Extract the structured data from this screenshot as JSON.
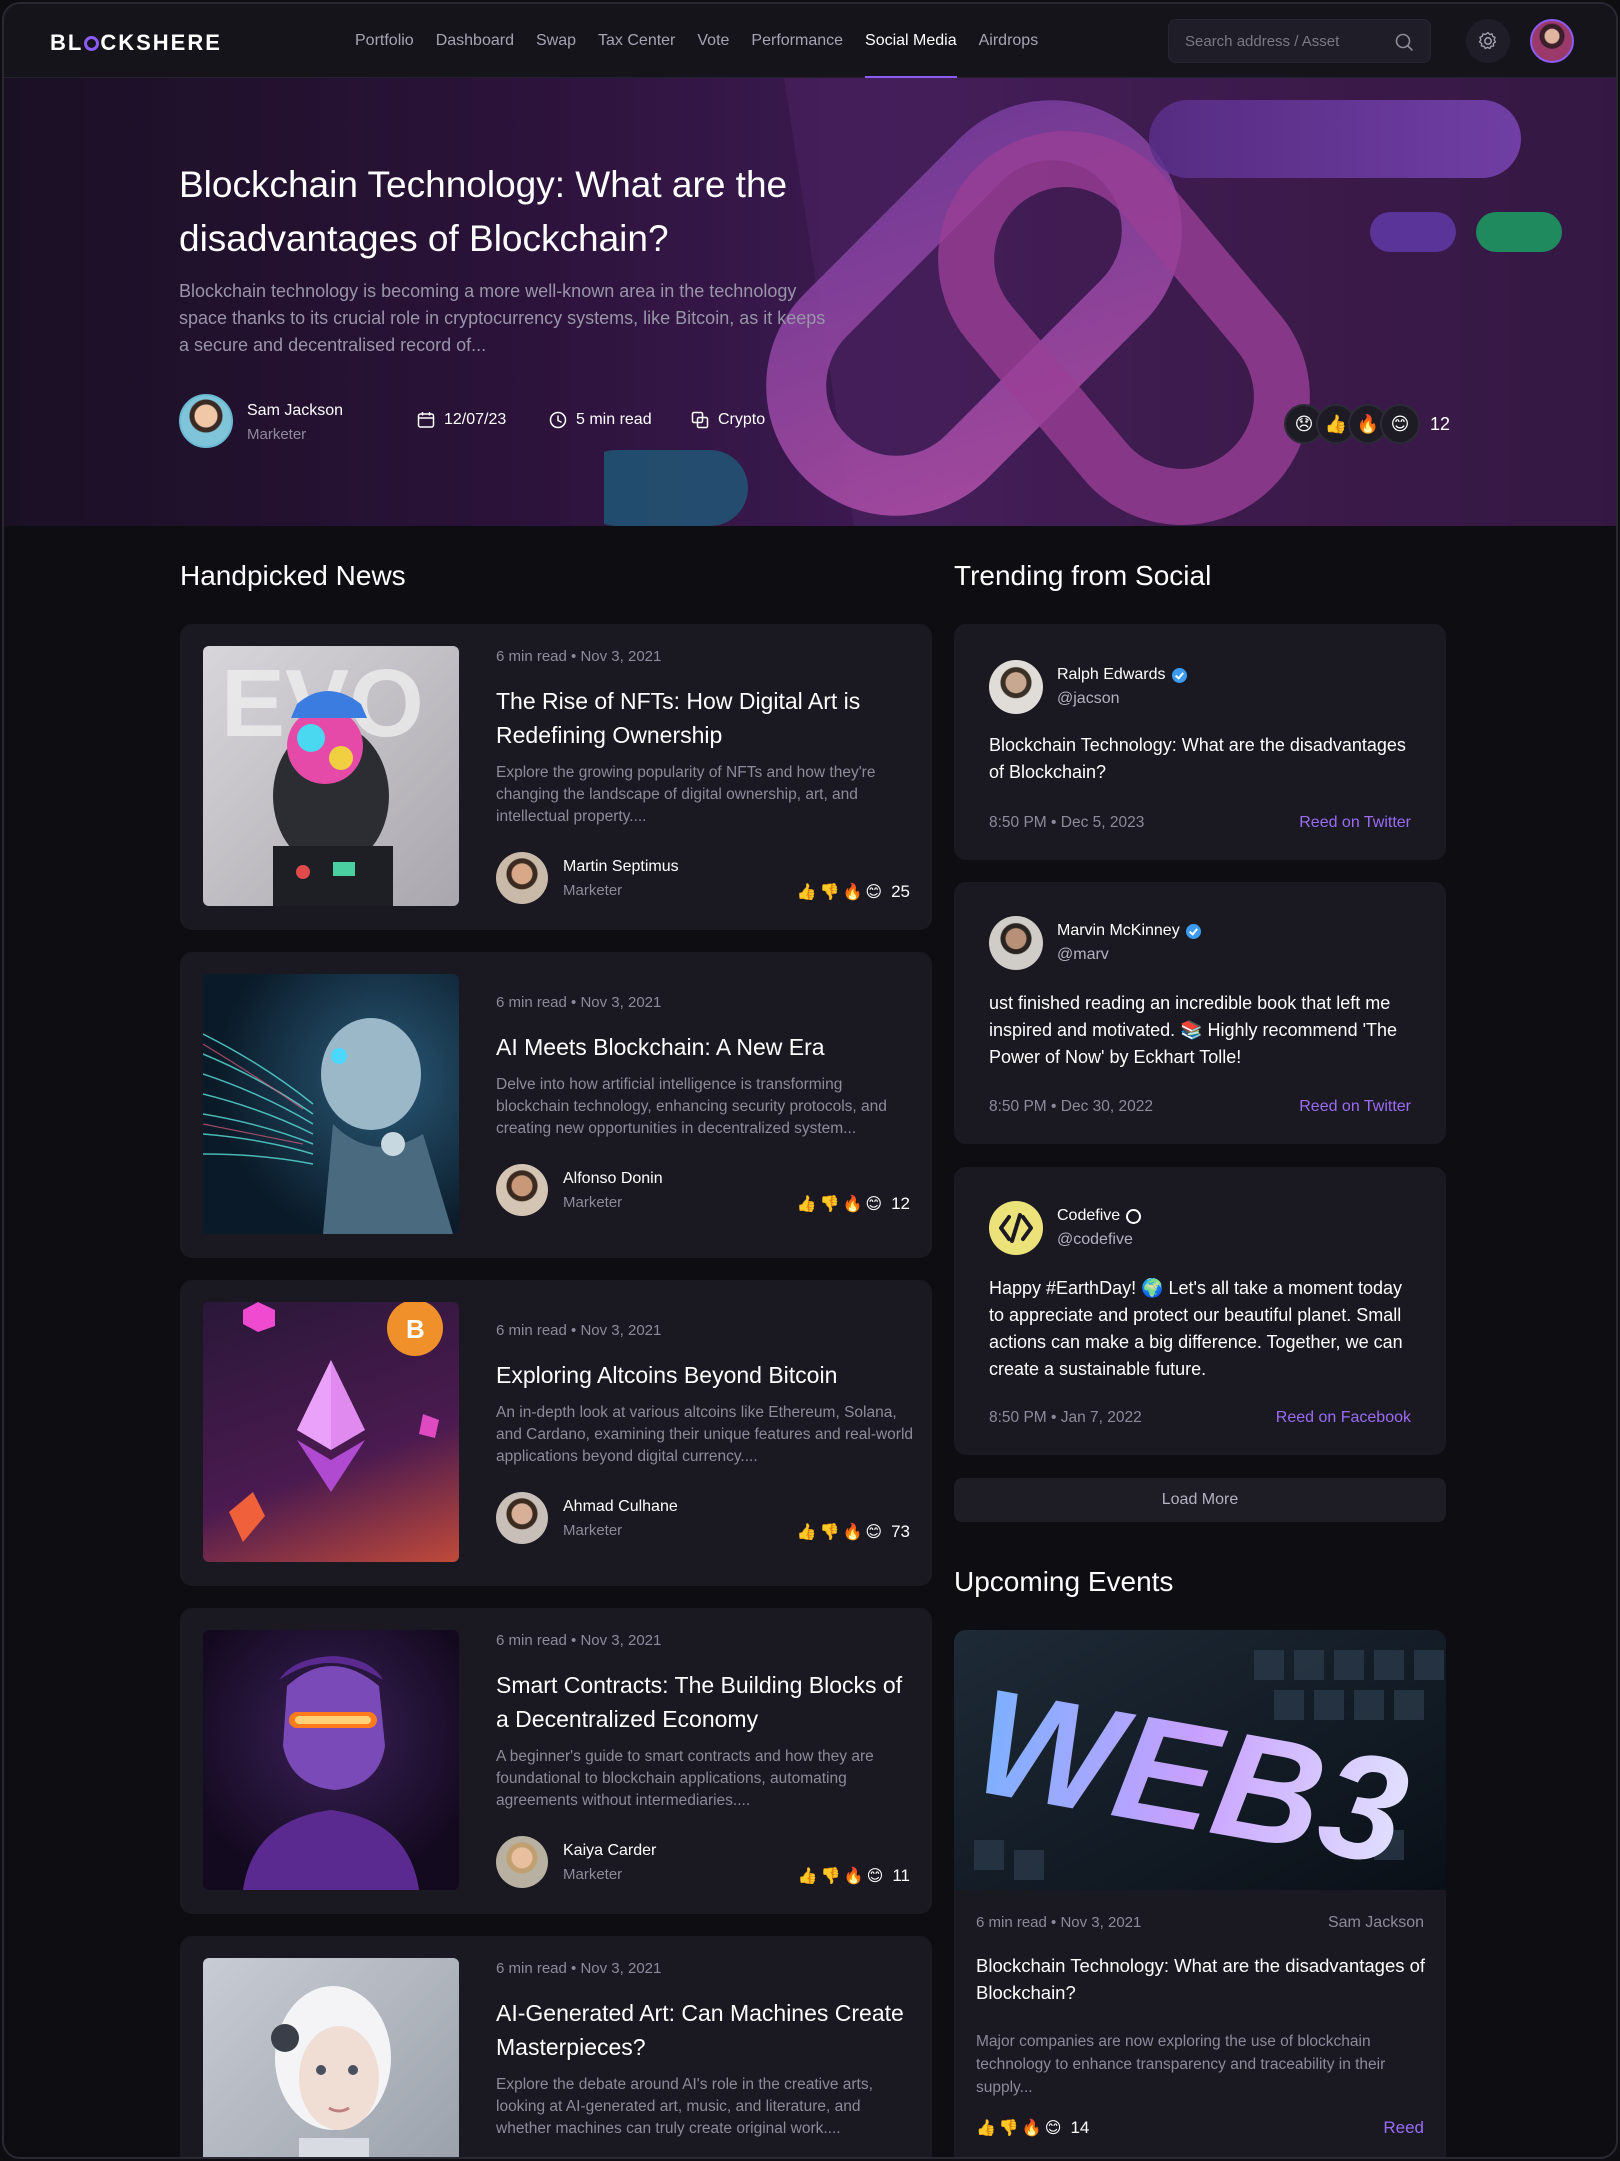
{
  "nav": {
    "logo_prefix": "BL",
    "logo_suffix": "CKSHERE",
    "links": [
      "Portfolio",
      "Dashboard",
      "Swap",
      "Tax Center",
      "Vote",
      "Performance",
      "Social Media",
      "Airdrops"
    ],
    "active_link": "Social Media",
    "search_placeholder": "Search address / Asset"
  },
  "hero": {
    "title": "Blockchain Technology: What are the disadvantages of Blockchain?",
    "description": "Blockchain technology is becoming a more well-known area in the technology space thanks to its crucial role in cryptocurrency systems, like Bitcoin, as it keeps a secure and decentralised record of...",
    "author_name": "Sam Jackson",
    "author_role": "Marketer",
    "date": "12/07/23",
    "read_time": "5 min read",
    "category": "Crypto",
    "reactions": [
      "😞",
      "👍",
      "🔥",
      "😊"
    ],
    "reaction_count": "12"
  },
  "handpicked": {
    "title": "Handpicked News",
    "items": [
      {
        "meta": "6 min read • Nov 3, 2021",
        "title": "The Rise of NFTs: How Digital Art is Redefining Ownership",
        "description": "Explore the growing popularity of NFTs and how they're changing the landscape of digital ownership, art, and intellectual property....",
        "author": "Martin Septimus",
        "role": "Marketer",
        "count": "25"
      },
      {
        "meta": "6 min read • Nov 3, 2021",
        "title": "AI Meets Blockchain: A New Era",
        "description": "Delve into how artificial intelligence is transforming blockchain technology, enhancing security protocols, and creating new opportunities in decentralized system...",
        "author": "Alfonso Donin",
        "role": "Marketer",
        "count": "12"
      },
      {
        "meta": "6 min read • Nov 3, 2021",
        "title": "Exploring Altcoins Beyond Bitcoin",
        "description": "An in-depth look at various altcoins like Ethereum, Solana, and Cardano, examining their unique features and real-world applications beyond digital currency....",
        "author": "Ahmad Culhane",
        "role": "Marketer",
        "count": "73"
      },
      {
        "meta": "6 min read • Nov 3, 2021",
        "title": "Smart Contracts: The Building Blocks of a Decentralized Economy",
        "description": "A beginner's guide to smart contracts and how they are foundational to blockchain applications, automating agreements without intermediaries....",
        "author": "Kaiya Carder",
        "role": "Marketer",
        "count": "11"
      },
      {
        "meta": "6 min read • Nov 3, 2021",
        "title": "AI-Generated Art: Can Machines Create Masterpieces?",
        "description": "Explore the debate around AI's role in the creative arts, looking at AI-generated art, music, and literature, and whether machines can truly create original work....",
        "author": "",
        "role": "",
        "count": ""
      }
    ],
    "reaction_icons": [
      "👍",
      "👎",
      "🔥",
      "😊"
    ]
  },
  "trending": {
    "title": "Trending from Social",
    "items": [
      {
        "name": "Ralph Edwards",
        "handle": "@jacson",
        "text": "Blockchain Technology: What are the disadvantages of Blockchain?",
        "date": "8:50 PM • Dec 5, 2023",
        "link": "Reed on Twitter"
      },
      {
        "name": "Marvin McKinney",
        "handle": "@marv",
        "text": "ust finished reading an incredible book that left me inspired and motivated. 📚 Highly recommend 'The Power of Now' by Eckhart Tolle!",
        "date": "8:50 PM • Dec 30, 2022",
        "link": "Reed on Twitter"
      },
      {
        "name": "Codefive",
        "handle": "@codefive",
        "text": "Happy #EarthDay! 🌍 Let's all take a moment today to appreciate and protect our beautiful planet. Small actions can make a big difference. Together, we can create a sustainable future.",
        "date": "8:50 PM • Jan 7, 2022",
        "link": "Reed on Facebook"
      }
    ],
    "load_more": "Load More"
  },
  "events": {
    "title": "Upcoming Events",
    "image_text": "WEB3",
    "meta": "6 min read • Nov 3, 2021",
    "author": "Sam Jackson",
    "card_title": "Blockchain Technology: What are the disadvantages of Blockchain?",
    "description": "Major companies are now exploring the use of blockchain technology to enhance transparency and traceability in their supply...",
    "reaction_icons": [
      "👍",
      "👎",
      "🔥",
      "😊"
    ],
    "count": "14",
    "read_label": "Reed"
  }
}
